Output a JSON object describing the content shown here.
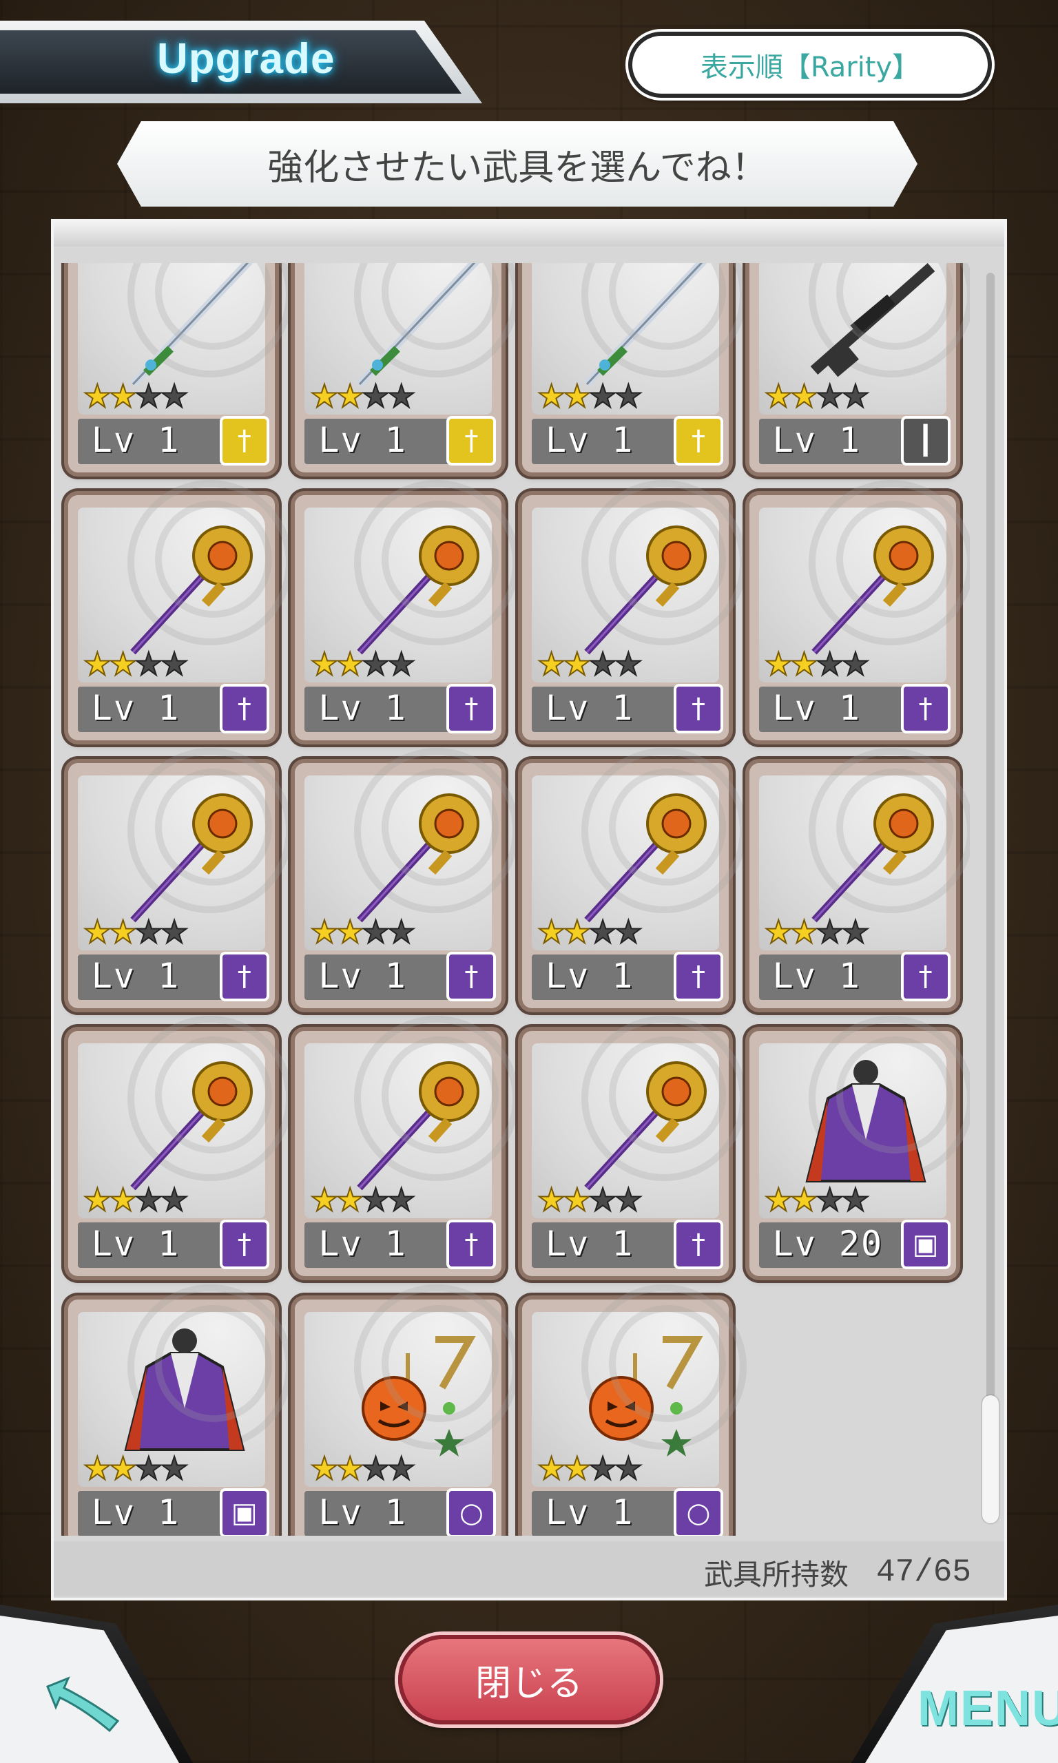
{
  "header": {
    "title": "Upgrade",
    "sort_label": "表示順【Rarity】"
  },
  "instruction": "強化させたい武具を選んでね！",
  "footer": {
    "count_label": "武具所持数",
    "count_value": "47/65"
  },
  "nav": {
    "close_label": "閉じる",
    "menu_label": "MENU"
  },
  "colors": {
    "sword": "#e3c31e",
    "gun": "#555555",
    "staff": "#6b3fa6",
    "accent": "#7ee3de"
  },
  "items": [
    {
      "type": "sword",
      "stars": 2,
      "level": "1",
      "badge_icon": "sword-icon"
    },
    {
      "type": "sword",
      "stars": 2,
      "level": "1",
      "badge_icon": "sword-icon"
    },
    {
      "type": "sword",
      "stars": 2,
      "level": "1",
      "badge_icon": "sword-icon"
    },
    {
      "type": "gun",
      "stars": 2,
      "level": "1",
      "badge_icon": "gun-icon"
    },
    {
      "type": "staff",
      "stars": 2,
      "level": "1",
      "badge_icon": "staff-icon"
    },
    {
      "type": "staff",
      "stars": 2,
      "level": "1",
      "badge_icon": "staff-icon"
    },
    {
      "type": "staff",
      "stars": 2,
      "level": "1",
      "badge_icon": "staff-icon"
    },
    {
      "type": "staff",
      "stars": 2,
      "level": "1",
      "badge_icon": "staff-icon"
    },
    {
      "type": "staff",
      "stars": 2,
      "level": "1",
      "badge_icon": "staff-icon"
    },
    {
      "type": "staff",
      "stars": 2,
      "level": "1",
      "badge_icon": "staff-icon"
    },
    {
      "type": "staff",
      "stars": 2,
      "level": "1",
      "badge_icon": "staff-icon"
    },
    {
      "type": "staff",
      "stars": 2,
      "level": "1",
      "badge_icon": "staff-icon"
    },
    {
      "type": "staff",
      "stars": 2,
      "level": "1",
      "badge_icon": "staff-icon"
    },
    {
      "type": "staff",
      "stars": 2,
      "level": "1",
      "badge_icon": "staff-icon"
    },
    {
      "type": "staff",
      "stars": 2,
      "level": "1",
      "badge_icon": "staff-icon"
    },
    {
      "type": "armor",
      "stars": 2,
      "level": "20",
      "badge_icon": "armor-icon"
    },
    {
      "type": "armor",
      "stars": 2,
      "level": "1",
      "badge_icon": "armor-icon"
    },
    {
      "type": "acc",
      "stars": 2,
      "level": "1",
      "badge_icon": "necklace-icon"
    },
    {
      "type": "acc",
      "stars": 2,
      "level": "1",
      "badge_icon": "necklace-icon"
    }
  ]
}
